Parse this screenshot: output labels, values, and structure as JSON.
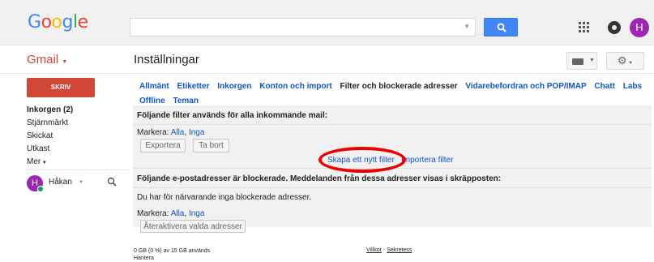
{
  "header": {
    "logo": [
      "G",
      "o",
      "o",
      "g",
      "l",
      "e"
    ],
    "logo_colors": [
      "#4285f4",
      "#ea4335",
      "#fbbc05",
      "#4285f4",
      "#34a853",
      "#ea4335"
    ],
    "avatar_letter": "H"
  },
  "app": {
    "label": "Gmail",
    "page_title": "Inställningar"
  },
  "sidebar": {
    "compose_label": "SKRIV",
    "items": [
      {
        "label": "Inkorgen (2)"
      },
      {
        "label": "Stjärnmärkt"
      },
      {
        "label": "Skickat"
      },
      {
        "label": "Utkast"
      },
      {
        "label": "Mer"
      }
    ],
    "user": {
      "name": "Håkan",
      "avatar_letter": "H"
    }
  },
  "settings": {
    "tabs": [
      {
        "label": "Allmänt"
      },
      {
        "label": "Etiketter"
      },
      {
        "label": "Inkorgen"
      },
      {
        "label": "Konton och import"
      },
      {
        "label": "Filter och blockerade adresser"
      },
      {
        "label": "Vidarebefordran och POP/IMAP"
      },
      {
        "label": "Chatt"
      },
      {
        "label": "Labs"
      },
      {
        "label": "Offline"
      },
      {
        "label": "Teman"
      }
    ],
    "filters": {
      "heading": "Följande filter används för alla inkommande mail:",
      "select_label": "Markera:",
      "select_all": "Alla",
      "select_none": "Inga",
      "export_button": "Exportera",
      "delete_button": "Ta bort",
      "create_filter": "Skapa ett nytt filter",
      "import_filter": "Importera filter"
    },
    "blocked": {
      "heading": "Följande e-postadresser är blockerade. Meddelanden från dessa adresser visas i skräpposten:",
      "empty_text": "Du har för närvarande inga blockerade adresser.",
      "select_label": "Markera:",
      "select_all": "Alla",
      "select_none": "Inga",
      "reactivate_button": "Återaktivera valda adresser"
    }
  },
  "footer": {
    "quota": "0 GB (0 %) av 15 GB används",
    "manage": "Hantera",
    "terms": "Villkor",
    "separator": "-",
    "privacy": "Sekretess"
  },
  "colors": {
    "accent": "#d14836",
    "link": "#1155cc",
    "search_button": "#4285f4",
    "avatar": "#9c27b0",
    "highlight_circle": "#ee0000"
  }
}
